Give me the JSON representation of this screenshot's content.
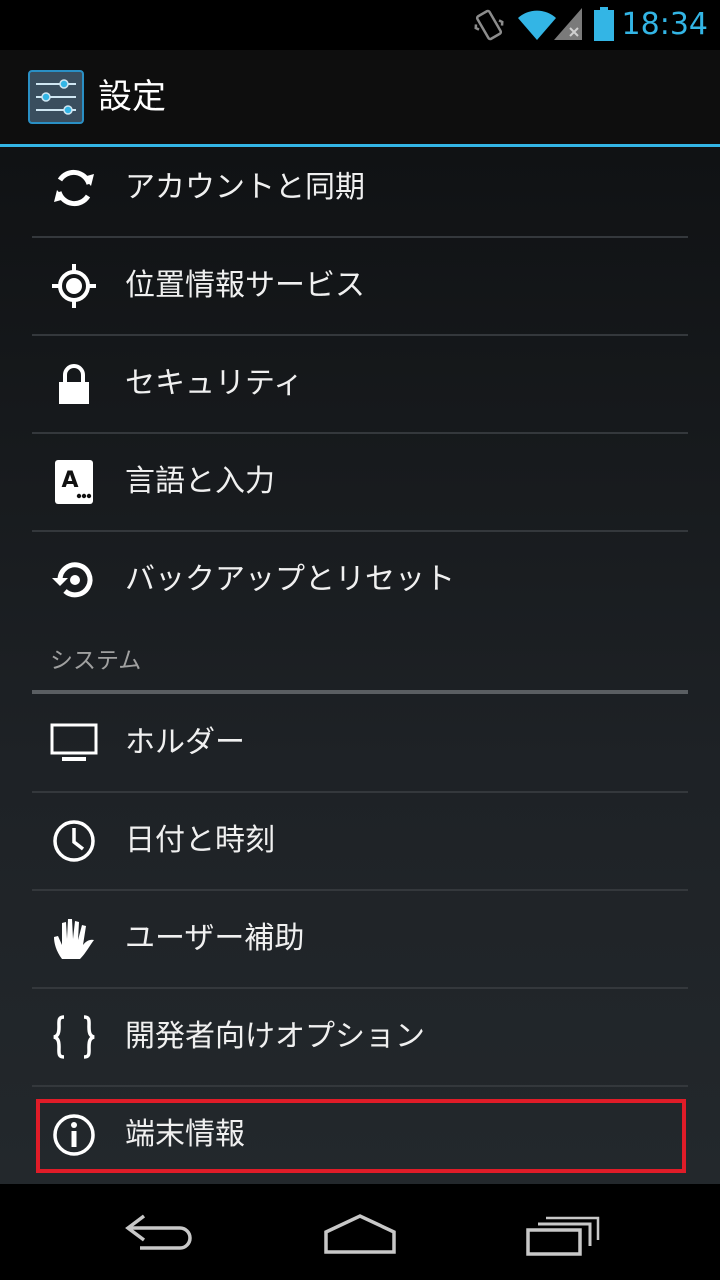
{
  "status_bar": {
    "time": "18:34",
    "icons": [
      "vibrate-icon",
      "wifi-icon",
      "signal-icon",
      "battery-icon"
    ],
    "accent_color": "#33b5e5"
  },
  "action_bar": {
    "title": "設定",
    "app_icon": "settings-sliders-icon",
    "accent_color": "#33b5e5"
  },
  "settings": {
    "personal_items": [
      {
        "label": "アカウントと同期",
        "icon": "sync-icon"
      },
      {
        "label": "位置情報サービス",
        "icon": "location-icon"
      },
      {
        "label": "セキュリティ",
        "icon": "lock-icon"
      },
      {
        "label": "言語と入力",
        "icon": "keyboard-language-icon"
      },
      {
        "label": "バックアップとリセット",
        "icon": "backup-restore-icon"
      }
    ],
    "system_header": "システム",
    "system_items": [
      {
        "label": "ホルダー",
        "icon": "monitor-icon"
      },
      {
        "label": "日付と時刻",
        "icon": "clock-icon"
      },
      {
        "label": "ユーザー補助",
        "icon": "hand-icon"
      },
      {
        "label": "開発者向けオプション",
        "icon": "braces-icon"
      },
      {
        "label": "端末情報",
        "icon": "info-icon",
        "highlighted": true
      }
    ],
    "highlight_color": "#e01c28"
  },
  "nav_bar": {
    "buttons": [
      "back-icon",
      "home-icon",
      "recent-apps-icon"
    ]
  }
}
